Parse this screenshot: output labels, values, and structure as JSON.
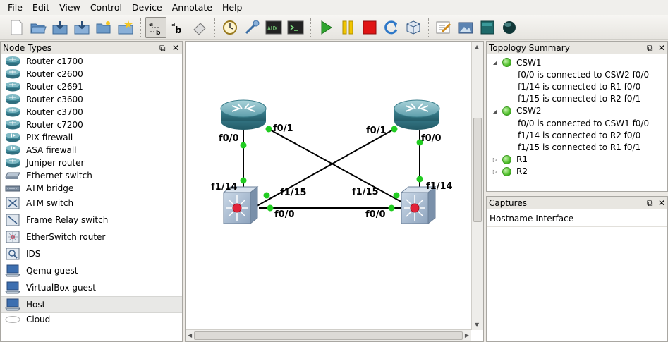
{
  "menu": [
    "File",
    "Edit",
    "View",
    "Control",
    "Device",
    "Annotate",
    "Help"
  ],
  "toolbar": {
    "icons": [
      "new-icon",
      "open-icon",
      "save-icon",
      "save-as-icon",
      "project-icon",
      "snapshot-icon",
      "add-link-icon",
      "show-names-icon",
      "eraser-icon",
      "clock-icon",
      "interface-icon",
      "aux-console-icon",
      "console-icon",
      "start-icon",
      "suspend-icon",
      "stop-icon",
      "reload-icon",
      "virtualbox-icon",
      "note-icon",
      "image-icon",
      "rectangle-icon",
      "ellipse-icon"
    ],
    "aux_label": "AUX"
  },
  "node_types": {
    "title": "Node Types",
    "items": [
      "Router c1700",
      "Router c2600",
      "Router c2691",
      "Router c3600",
      "Router c3700",
      "Router c7200",
      "PIX firewall",
      "ASA firewall",
      "Juniper router",
      "Ethernet switch",
      "ATM bridge",
      "ATM switch",
      "Frame Relay switch",
      "EtherSwitch router",
      "IDS",
      "Qemu guest",
      "VirtualBox guest",
      "Host",
      "Cloud"
    ],
    "selected": "Host"
  },
  "canvas": {
    "labels": {
      "r1_f00": "f0/0",
      "r1_f01": "f0/1",
      "r2_f01": "f0/1",
      "r2_f00": "f0/0",
      "csw1_f114": "f1/14",
      "csw1_f115": "f1/15",
      "csw1_f00": "f0/0",
      "csw2_f115": "f1/15",
      "csw2_f114": "f1/14",
      "csw2_f00": "f0/0"
    }
  },
  "topology": {
    "title": "Topology Summary",
    "nodes": [
      {
        "name": "CSW1",
        "expanded": true,
        "links": [
          "f0/0 is connected to CSW2 f0/0",
          "f1/14 is connected to R1 f0/0",
          "f1/15 is connected to R2 f0/1"
        ]
      },
      {
        "name": "CSW2",
        "expanded": true,
        "links": [
          "f0/0 is connected to CSW1 f0/0",
          "f1/14 is connected to R2 f0/0",
          "f1/15 is connected to R1 f0/1"
        ]
      },
      {
        "name": "R1",
        "expanded": false,
        "links": []
      },
      {
        "name": "R2",
        "expanded": false,
        "links": []
      }
    ]
  },
  "captures": {
    "title": "Captures",
    "columns": [
      "Hostname",
      "Interface"
    ]
  },
  "colors": {
    "link_dot": "#22cc22",
    "status_green": "#4fbf2a"
  }
}
